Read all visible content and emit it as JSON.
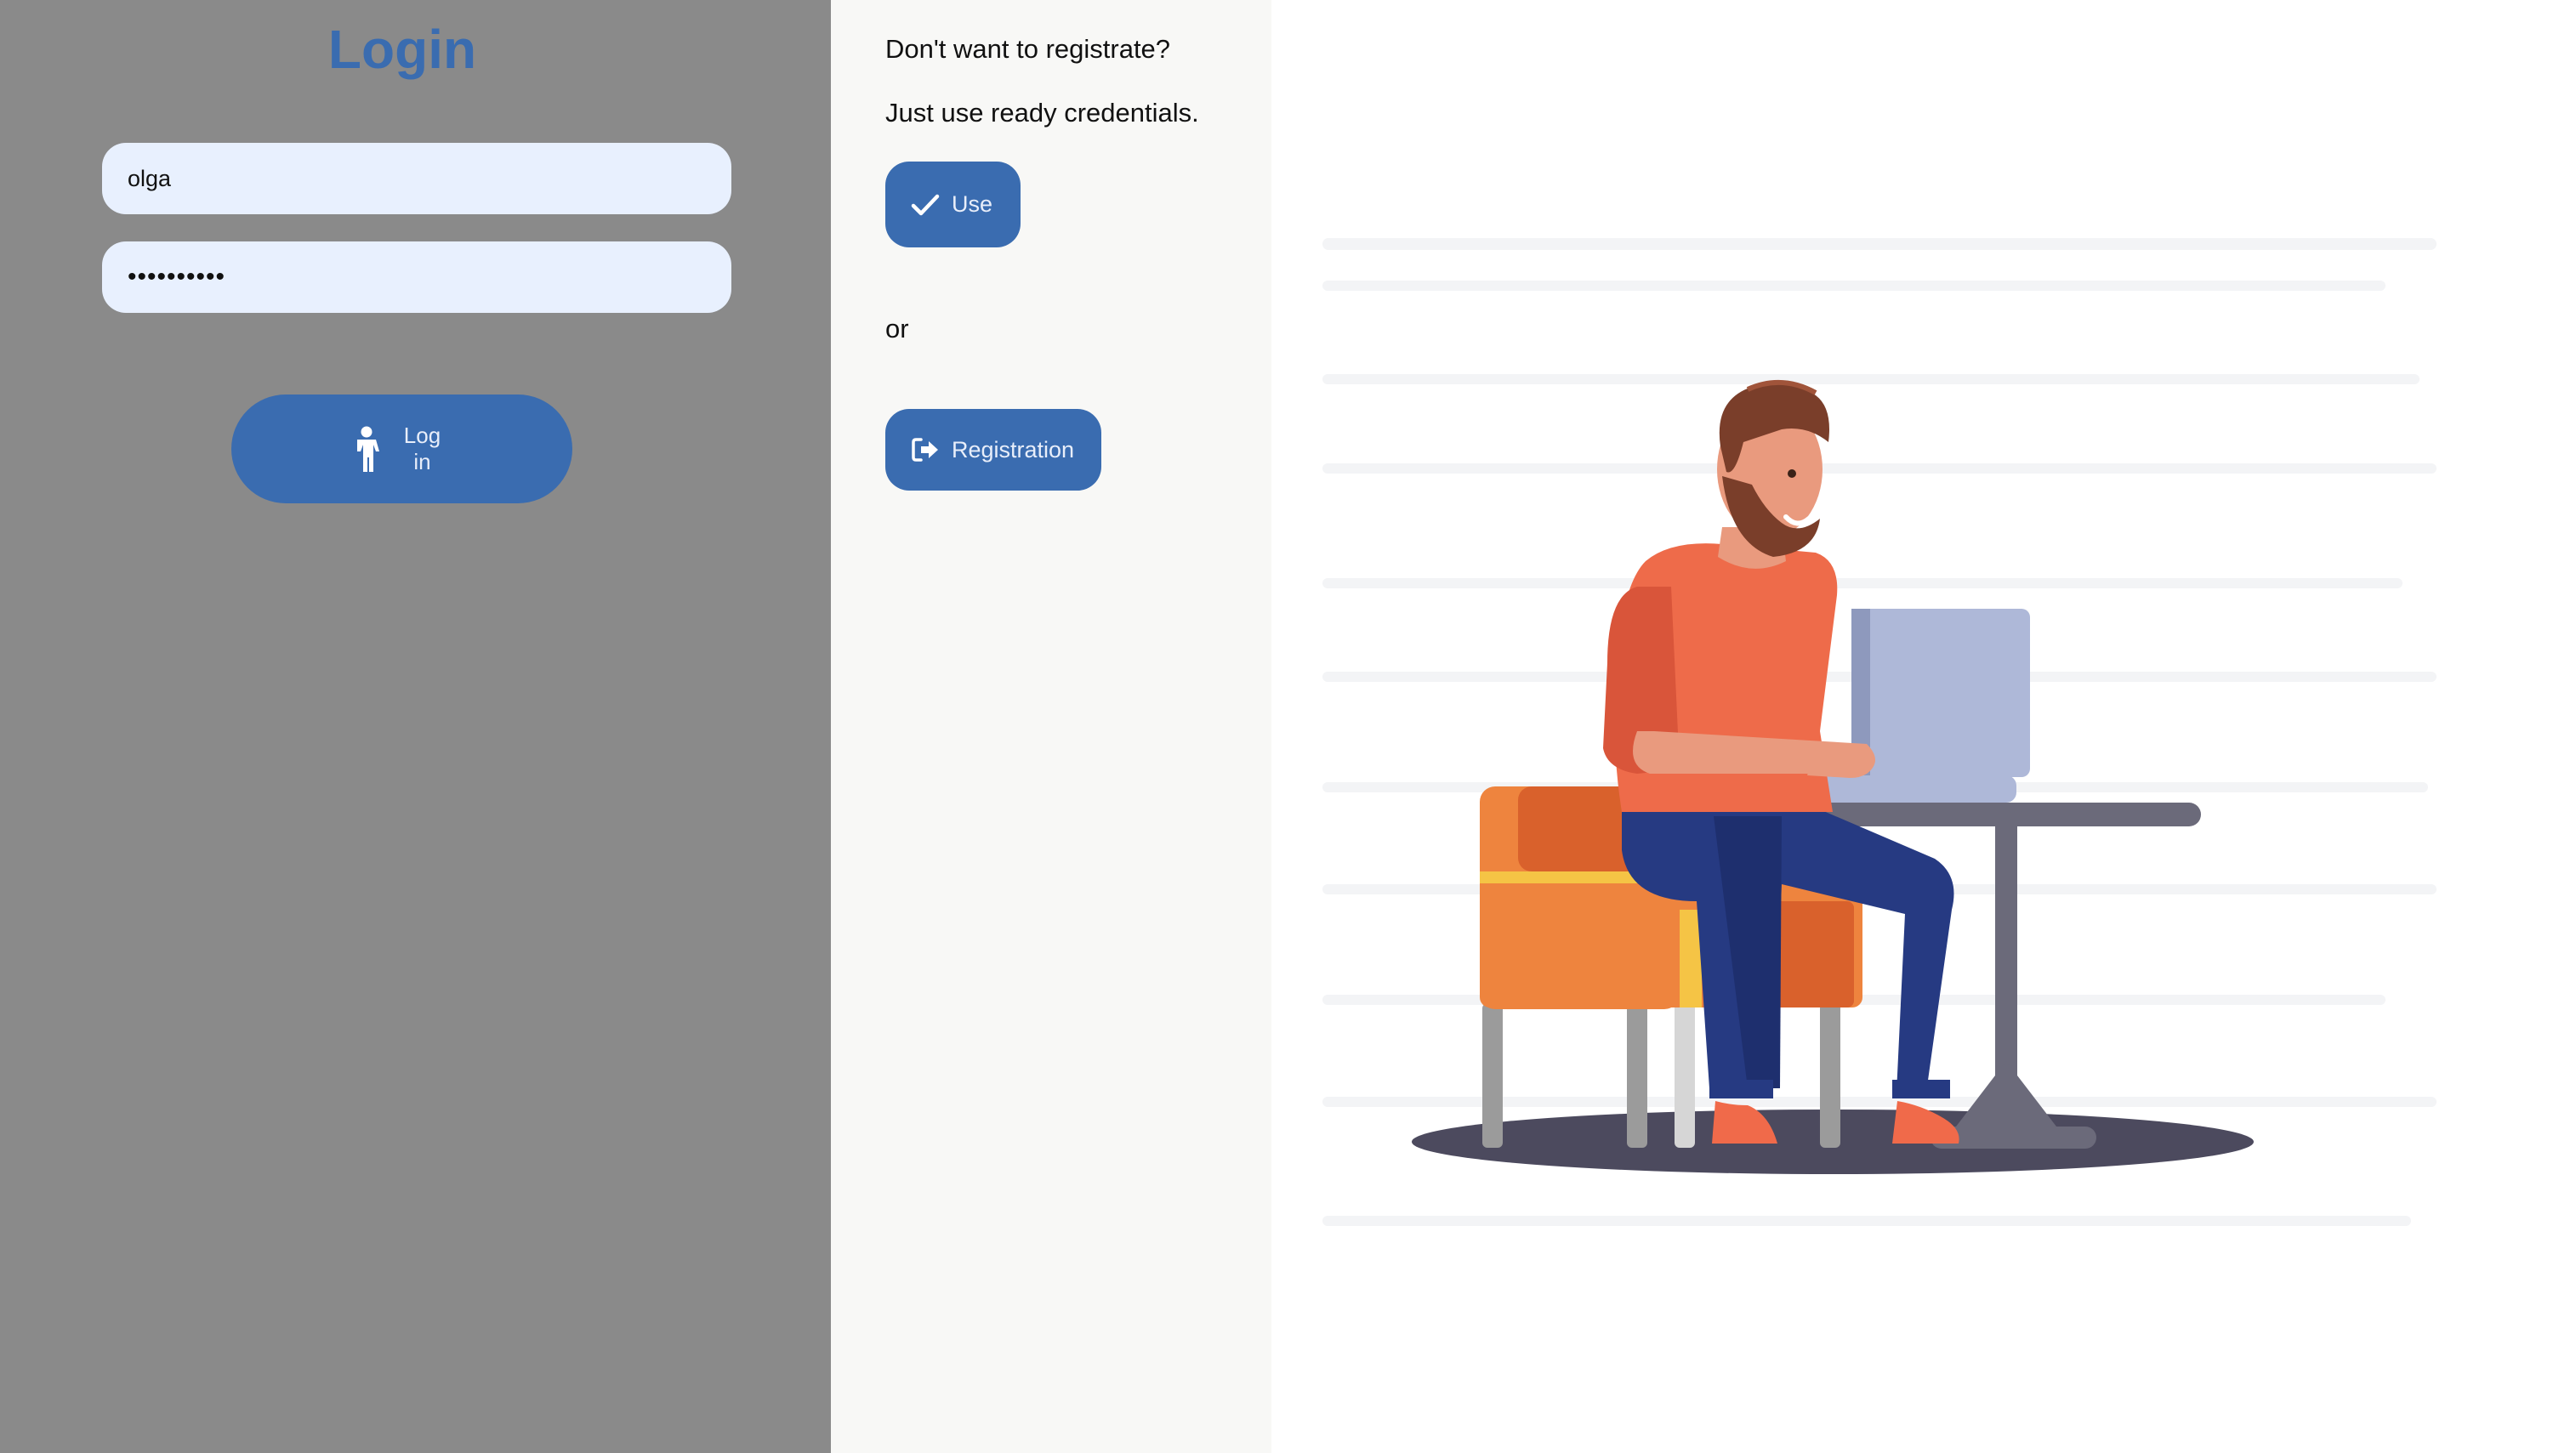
{
  "login": {
    "title": "Login",
    "username_value": "olga",
    "password_value": "••••••••••",
    "button_label_line1": "Log",
    "button_label_line2": "in",
    "button_icon": "child-person-icon"
  },
  "guest": {
    "question": "Don't want to registrate?",
    "hint": "Just use ready credentials.",
    "use_label": "Use",
    "use_icon": "checkmark-icon",
    "or_text": "or",
    "registration_label": "Registration",
    "registration_icon": "sign-in-arrow-icon"
  },
  "colors": {
    "accent": "#3a6cb0",
    "login_bg": "#8a8a8a",
    "middle_bg": "#f8f8f6",
    "input_bg": "#e8f0fe"
  },
  "illustration": {
    "subject": "man-working-at-laptop-illustration"
  }
}
